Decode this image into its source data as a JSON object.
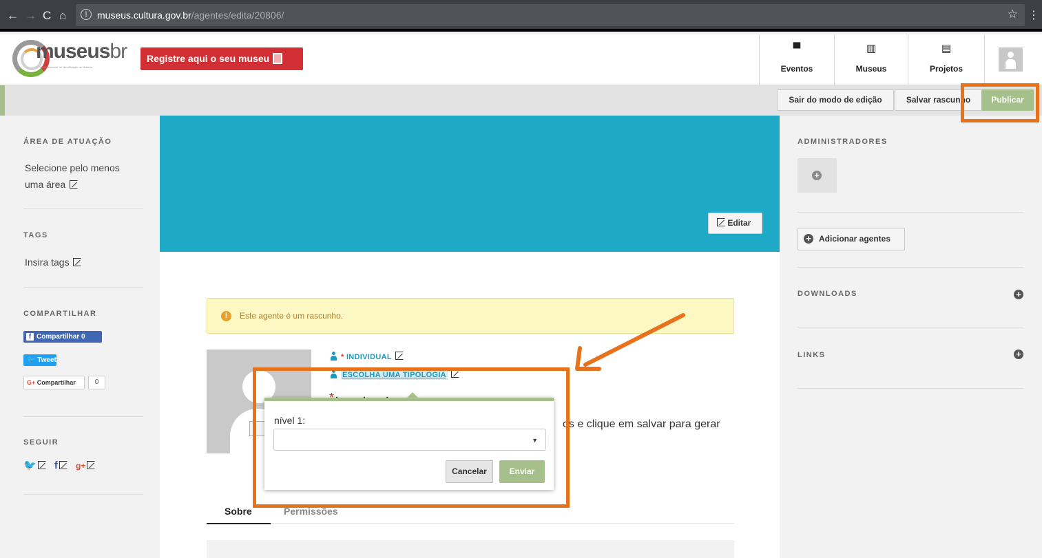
{
  "browser": {
    "url_host": "museus.cultura.gov.br",
    "url_path": "/agentes/edita/20806/"
  },
  "header": {
    "brand_main": "museus",
    "brand_suffix": "br",
    "brand_tagline": "Rede Nacional de Identificação de Museus",
    "register_label": "Registre aqui o seu museu",
    "nav": [
      {
        "label": "Eventos",
        "icon": "calendar-icon"
      },
      {
        "label": "Museus",
        "icon": "building-icon"
      },
      {
        "label": "Projetos",
        "icon": "document-icon"
      }
    ]
  },
  "toolbar": {
    "exit_label": "Sair do modo de edição",
    "draft_label": "Salvar rascunho",
    "publish_label": "Publicar"
  },
  "left": {
    "area_title": "ÁREA DE ATUAÇÃO",
    "area_line1": "Selecione pelo menos",
    "area_line2": "uma área",
    "tags_title": "TAGS",
    "tags_text": "Insira tags",
    "share_title": "COMPARTILHAR",
    "fb_share": "Compartilhar 0",
    "tweet": "Tweet",
    "gplus_share": "Compartilhar",
    "gplus_count": "0",
    "follow_title": "SEGUIR"
  },
  "center": {
    "edit_cover": "Editar",
    "draft_alert": "Este agente é um rascunho.",
    "type_label": "INDIVIDUAL",
    "type_required_mark": "*",
    "typology_label": "ESCOLHA UMA TIPOLOGIA",
    "agent_name": "teste teste",
    "description_partial": "os e clique em salvar para gerar",
    "tabs": [
      "Sobre",
      "Permissões"
    ]
  },
  "right": {
    "admins_title": "ADMINISTRADORES",
    "add_agents": "Adicionar agentes",
    "downloads_title": "DOWNLOADS",
    "links_title": "LINKS"
  },
  "popover": {
    "level_label": "nível 1:",
    "selected_value": "",
    "cancel_label": "Cancelar",
    "send_label": "Enviar"
  },
  "colors": {
    "accent_green": "#a5c08a",
    "cover_blue": "#1eaac6",
    "register_red": "#d12f33",
    "annotation_orange": "#e8711b",
    "link_blue": "#1a9bc1"
  }
}
